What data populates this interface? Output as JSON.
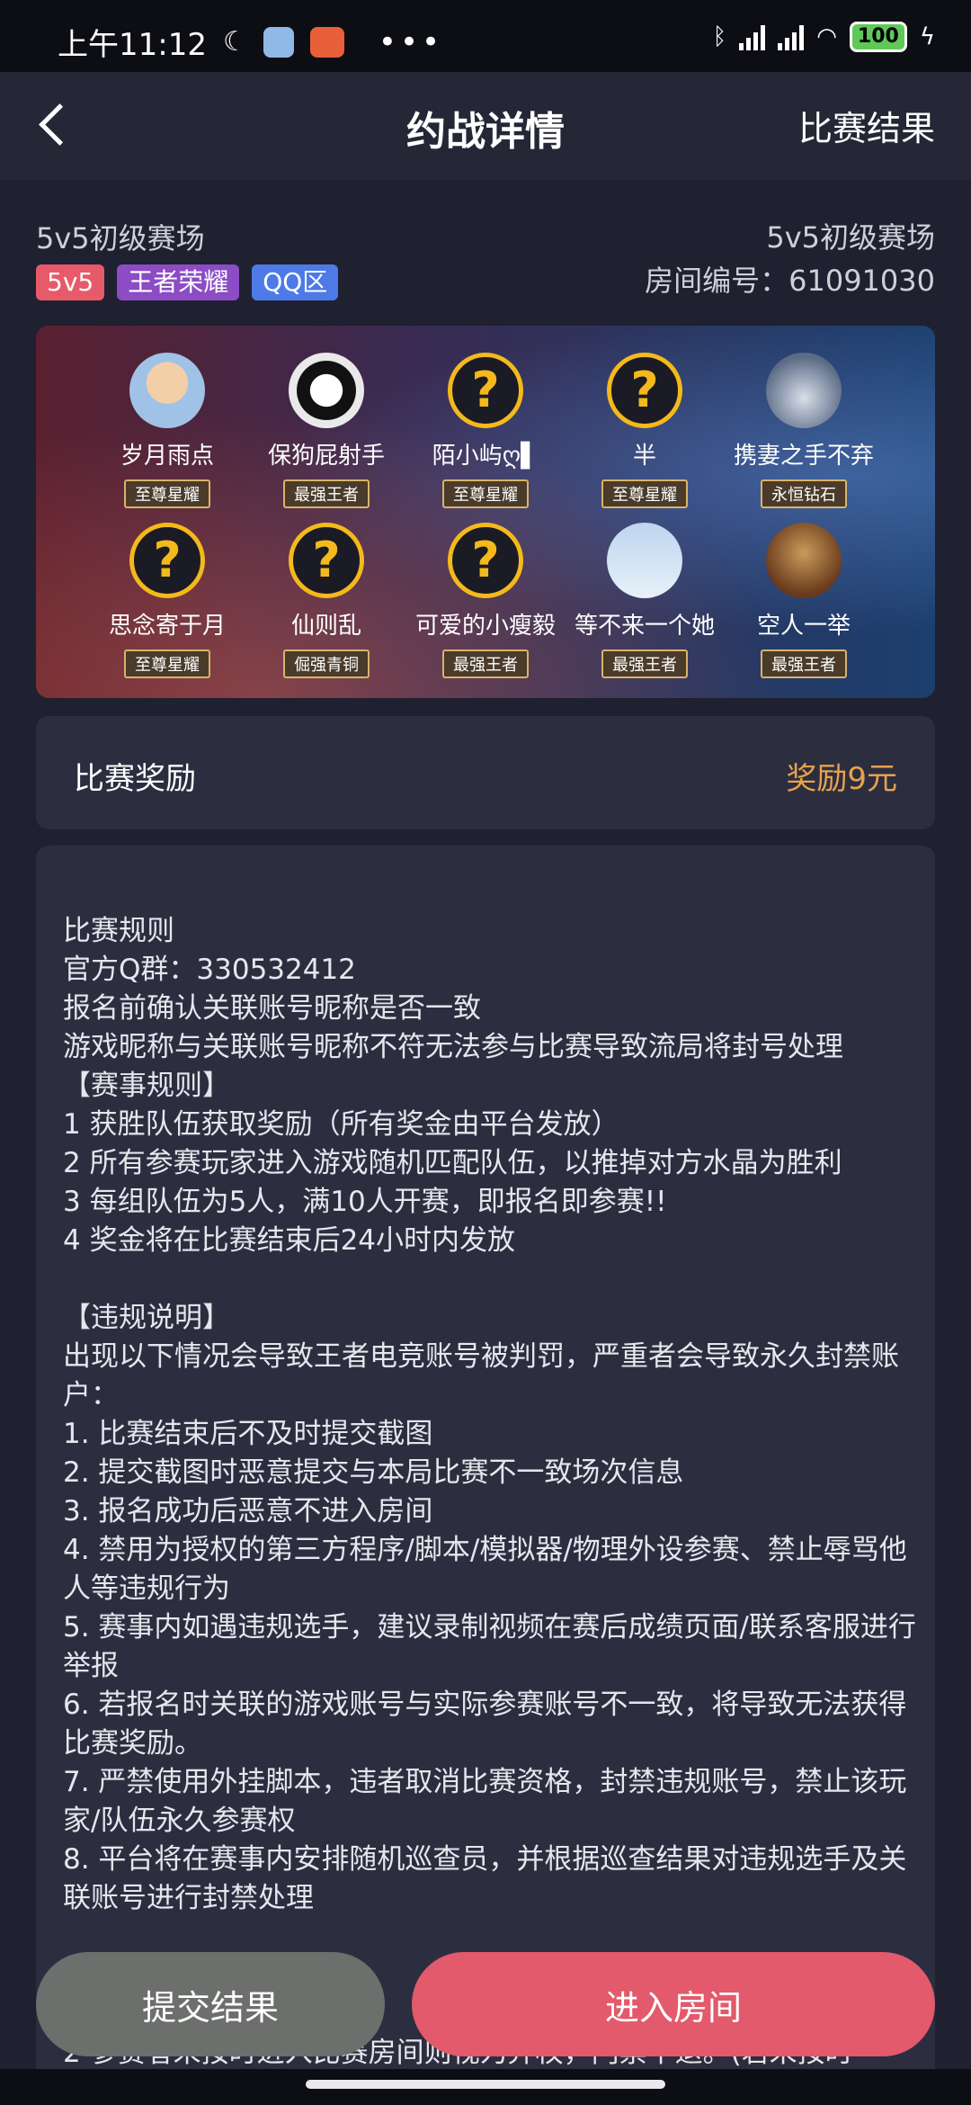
{
  "status_bar": {
    "time": "上午11:12",
    "dots": "•••",
    "battery": "100"
  },
  "header": {
    "title": "约战详情",
    "right_link": "比赛结果"
  },
  "match": {
    "arena_left": "5v5初级赛场",
    "arena_right": "5v5初级赛场",
    "room_number": "房间编号：61091030",
    "tags": [
      "5v5",
      "王者荣耀",
      "QQ区"
    ]
  },
  "players": [
    {
      "name": "岁月雨点",
      "rank": "至尊星耀",
      "avatar": "baby-photo"
    },
    {
      "name": "保狗屁射手",
      "rank": "最强王者",
      "avatar": "anime-portrait"
    },
    {
      "name": "陌小屿ღ▌",
      "rank": "至尊星耀",
      "avatar": "question-mark"
    },
    {
      "name": "半",
      "rank": "至尊星耀",
      "avatar": "question-mark"
    },
    {
      "name": "携妻之手不弃",
      "rank": "永恒钻石",
      "avatar": "sky-photo"
    },
    {
      "name": "思念寄于月",
      "rank": "至尊星耀",
      "avatar": "question-mark"
    },
    {
      "name": "仙则乱",
      "rank": "倔强青铜",
      "avatar": "question-mark"
    },
    {
      "name": "可爱的小瘦毅",
      "rank": "最强王者",
      "avatar": "question-mark"
    },
    {
      "name": "等不来一个她",
      "rank": "最强王者",
      "avatar": "snow-photo"
    },
    {
      "name": "空人一举",
      "rank": "最强王者",
      "avatar": "warrior-photo"
    }
  ],
  "reward": {
    "label": "比赛奖励",
    "value": "奖励9元"
  },
  "rules": [
    "比赛规则",
    "官方Q群：330532412",
    "报名前确认关联账号昵称是否一致",
    "游戏昵称与关联账号昵称不符无法参与比赛导致流局将封号处理",
    "【赛事规则】",
    "1 获胜队伍获取奖励（所有奖金由平台发放）",
    "2 所有参赛玩家进入游戏随机匹配队伍，以推掉对方水晶为胜利",
    "3 每组队伍为5人，满10人开赛，即报名即参赛!!",
    "4 奖金将在比赛结束后24小时内发放",
    "",
    "【违规说明】",
    "出现以下情况会导致王者电竞账号被判罚，严重者会导致永久封禁账户：",
    "1. 比赛结束后不及时提交截图",
    "2. 提交截图时恶意提交与本局比赛不一致场次信息",
    "3. 报名成功后恶意不进入房间",
    "4. 禁用为授权的第三方程序/脚本/模拟器/物理外设参赛、禁止辱骂他人等违规行为",
    "5. 赛事内如遇违规选手，建议录制视频在赛后成绩页面/联系客服进行举报",
    "6. 若报名时关联的游戏账号与实际参赛账号不一致，将导致无法获得比赛奖励。",
    "7. 严禁使用外挂脚本，违者取消比赛资格，封禁违规账号，禁止该玩家/队伍永久参赛权",
    "8. 平台将在赛事内安排随机巡查员，并根据巡查结果对违规选手及关联账号进行封禁处理",
    "",
    "",
    "",
    "2 参赛者未按时进入比赛房间则视为弃权，门票不退。(若未按时"
  ],
  "buttons": {
    "submit": "提交结果",
    "enter": "进入房间"
  }
}
